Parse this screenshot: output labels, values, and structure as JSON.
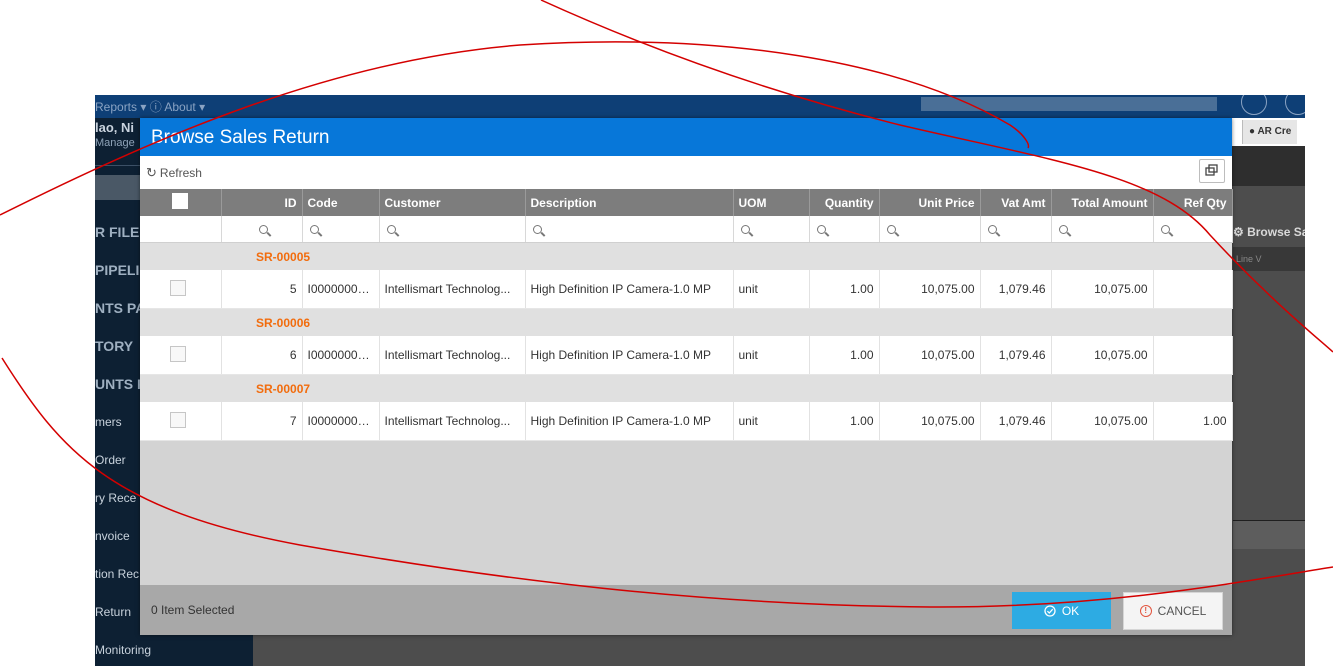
{
  "background_app": {
    "top_menu": "Reports ▾   ⓘ About ▾",
    "user_name": "lao, Ni",
    "user_role": "Manage",
    "sidebar_items": [
      "R FILE",
      "PIPELIN",
      "NTS PA",
      "TORY",
      "UNTS R",
      "mers",
      "Order",
      "ry Rece",
      "nvoice",
      "tion Rec",
      "Return",
      "Monitoring"
    ],
    "tab_label": "AR Cre",
    "browse_label": "Browse Sa",
    "line_label": "Line V"
  },
  "modal": {
    "title": "Browse Sales Return",
    "toolbar": {
      "refresh_label": "Refresh",
      "restore_icon": "window-restore-icon"
    },
    "columns": [
      {
        "key": "select",
        "label": ""
      },
      {
        "key": "id",
        "label": "ID"
      },
      {
        "key": "code",
        "label": "Code"
      },
      {
        "key": "customer",
        "label": "Customer"
      },
      {
        "key": "description",
        "label": "Description"
      },
      {
        "key": "uom",
        "label": "UOM"
      },
      {
        "key": "quantity",
        "label": "Quantity"
      },
      {
        "key": "unit_price",
        "label": "Unit Price"
      },
      {
        "key": "vat_amt",
        "label": "Vat Amt"
      },
      {
        "key": "total_amount",
        "label": "Total Amount"
      },
      {
        "key": "ref_qty",
        "label": "Ref Qty"
      }
    ],
    "groups": [
      {
        "label": "SR-00005",
        "row": {
          "id": "5",
          "code": "I00000000...",
          "customer": "Intellismart Technolog...",
          "description": "High Definition IP Camera-1.0 MP",
          "uom": "unit",
          "quantity": "1.00",
          "unit_price": "10,075.00",
          "vat_amt": "1,079.46",
          "total_amount": "10,075.00",
          "ref_qty": ""
        }
      },
      {
        "label": "SR-00006",
        "row": {
          "id": "6",
          "code": "I00000000...",
          "customer": "Intellismart Technolog...",
          "description": "High Definition IP Camera-1.0 MP",
          "uom": "unit",
          "quantity": "1.00",
          "unit_price": "10,075.00",
          "vat_amt": "1,079.46",
          "total_amount": "10,075.00",
          "ref_qty": ""
        }
      },
      {
        "label": "SR-00007",
        "row": {
          "id": "7",
          "code": "I00000000...",
          "customer": "Intellismart Technolog...",
          "description": "High Definition IP Camera-1.0 MP",
          "uom": "unit",
          "quantity": "1.00",
          "unit_price": "10,075.00",
          "vat_amt": "1,079.46",
          "total_amount": "10,075.00",
          "ref_qty": "1.00"
        }
      }
    ],
    "footer": {
      "selected_count": "0 Item Selected",
      "ok_label": "OK",
      "cancel_label": "CANCEL"
    }
  },
  "colors": {
    "header_blue": "#0777d9",
    "ok_button": "#2dabe3",
    "group_label": "#f26c0d",
    "scribble": "#d40000"
  }
}
